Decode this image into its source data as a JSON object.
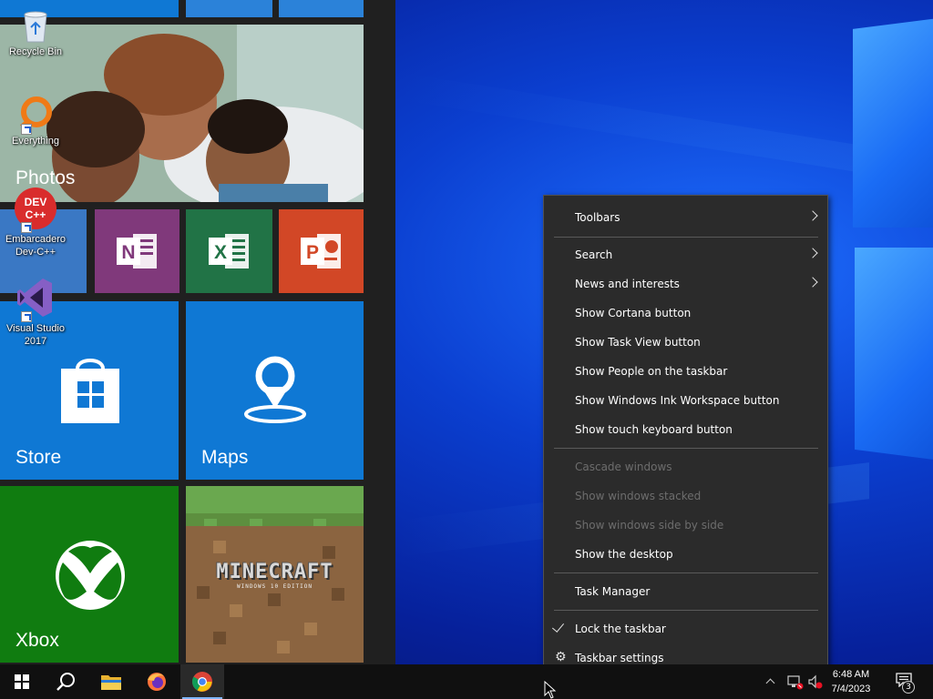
{
  "start_menu": {
    "tiles": {
      "photos": "Photos",
      "store": "Store",
      "maps": "Maps",
      "xbox": "Xbox",
      "minecraft_logo": "MINECRAFT",
      "minecraft_sub": "WINDOWS 10 EDITION"
    }
  },
  "desktop_icons": [
    {
      "label": "Recycle Bin",
      "icon": "recycle-bin-icon"
    },
    {
      "label": "Everything",
      "icon": "everything-search-icon"
    },
    {
      "label": "Embarcadero Dev-C++",
      "icon": "devcpp-icon",
      "badge": "DEV C++"
    },
    {
      "label": "Visual Studio 2017",
      "icon": "visual-studio-icon"
    }
  ],
  "context_menu": {
    "items": [
      {
        "label": "Toolbars",
        "submenu": true,
        "enabled": true
      },
      {
        "label": "Search",
        "submenu": true,
        "enabled": true
      },
      {
        "label": "News and interests",
        "submenu": true,
        "enabled": true
      },
      {
        "label": "Show Cortana button",
        "enabled": true
      },
      {
        "label": "Show Task View button",
        "enabled": true
      },
      {
        "label": "Show People on the taskbar",
        "enabled": true
      },
      {
        "label": "Show Windows Ink Workspace button",
        "enabled": true
      },
      {
        "label": "Show touch keyboard button",
        "enabled": true
      },
      {
        "label": "Cascade windows",
        "enabled": false
      },
      {
        "label": "Show windows stacked",
        "enabled": false
      },
      {
        "label": "Show windows side by side",
        "enabled": false
      },
      {
        "label": "Show the desktop",
        "enabled": true
      },
      {
        "label": "Task Manager",
        "enabled": true
      },
      {
        "label": "Lock the taskbar",
        "enabled": true,
        "checked": true
      },
      {
        "label": "Taskbar settings",
        "enabled": true,
        "icon": "gear-icon"
      }
    ]
  },
  "taskbar": {
    "pinned": [
      "start-button",
      "search-button",
      "file-explorer",
      "firefox",
      "chrome"
    ],
    "clock": {
      "time": "6:48 AM",
      "date": "7/4/2023"
    },
    "notifications_count": "3"
  },
  "colors": {
    "menu_bg": "#2b2b2b",
    "taskbar_bg": "#101010",
    "start_bg": "#202020",
    "store_tile": "#0f78d4",
    "xbox_tile": "#107c10",
    "onenote_tile": "#80397b",
    "excel_tile": "#217346",
    "powerpoint_tile": "#d24726"
  }
}
